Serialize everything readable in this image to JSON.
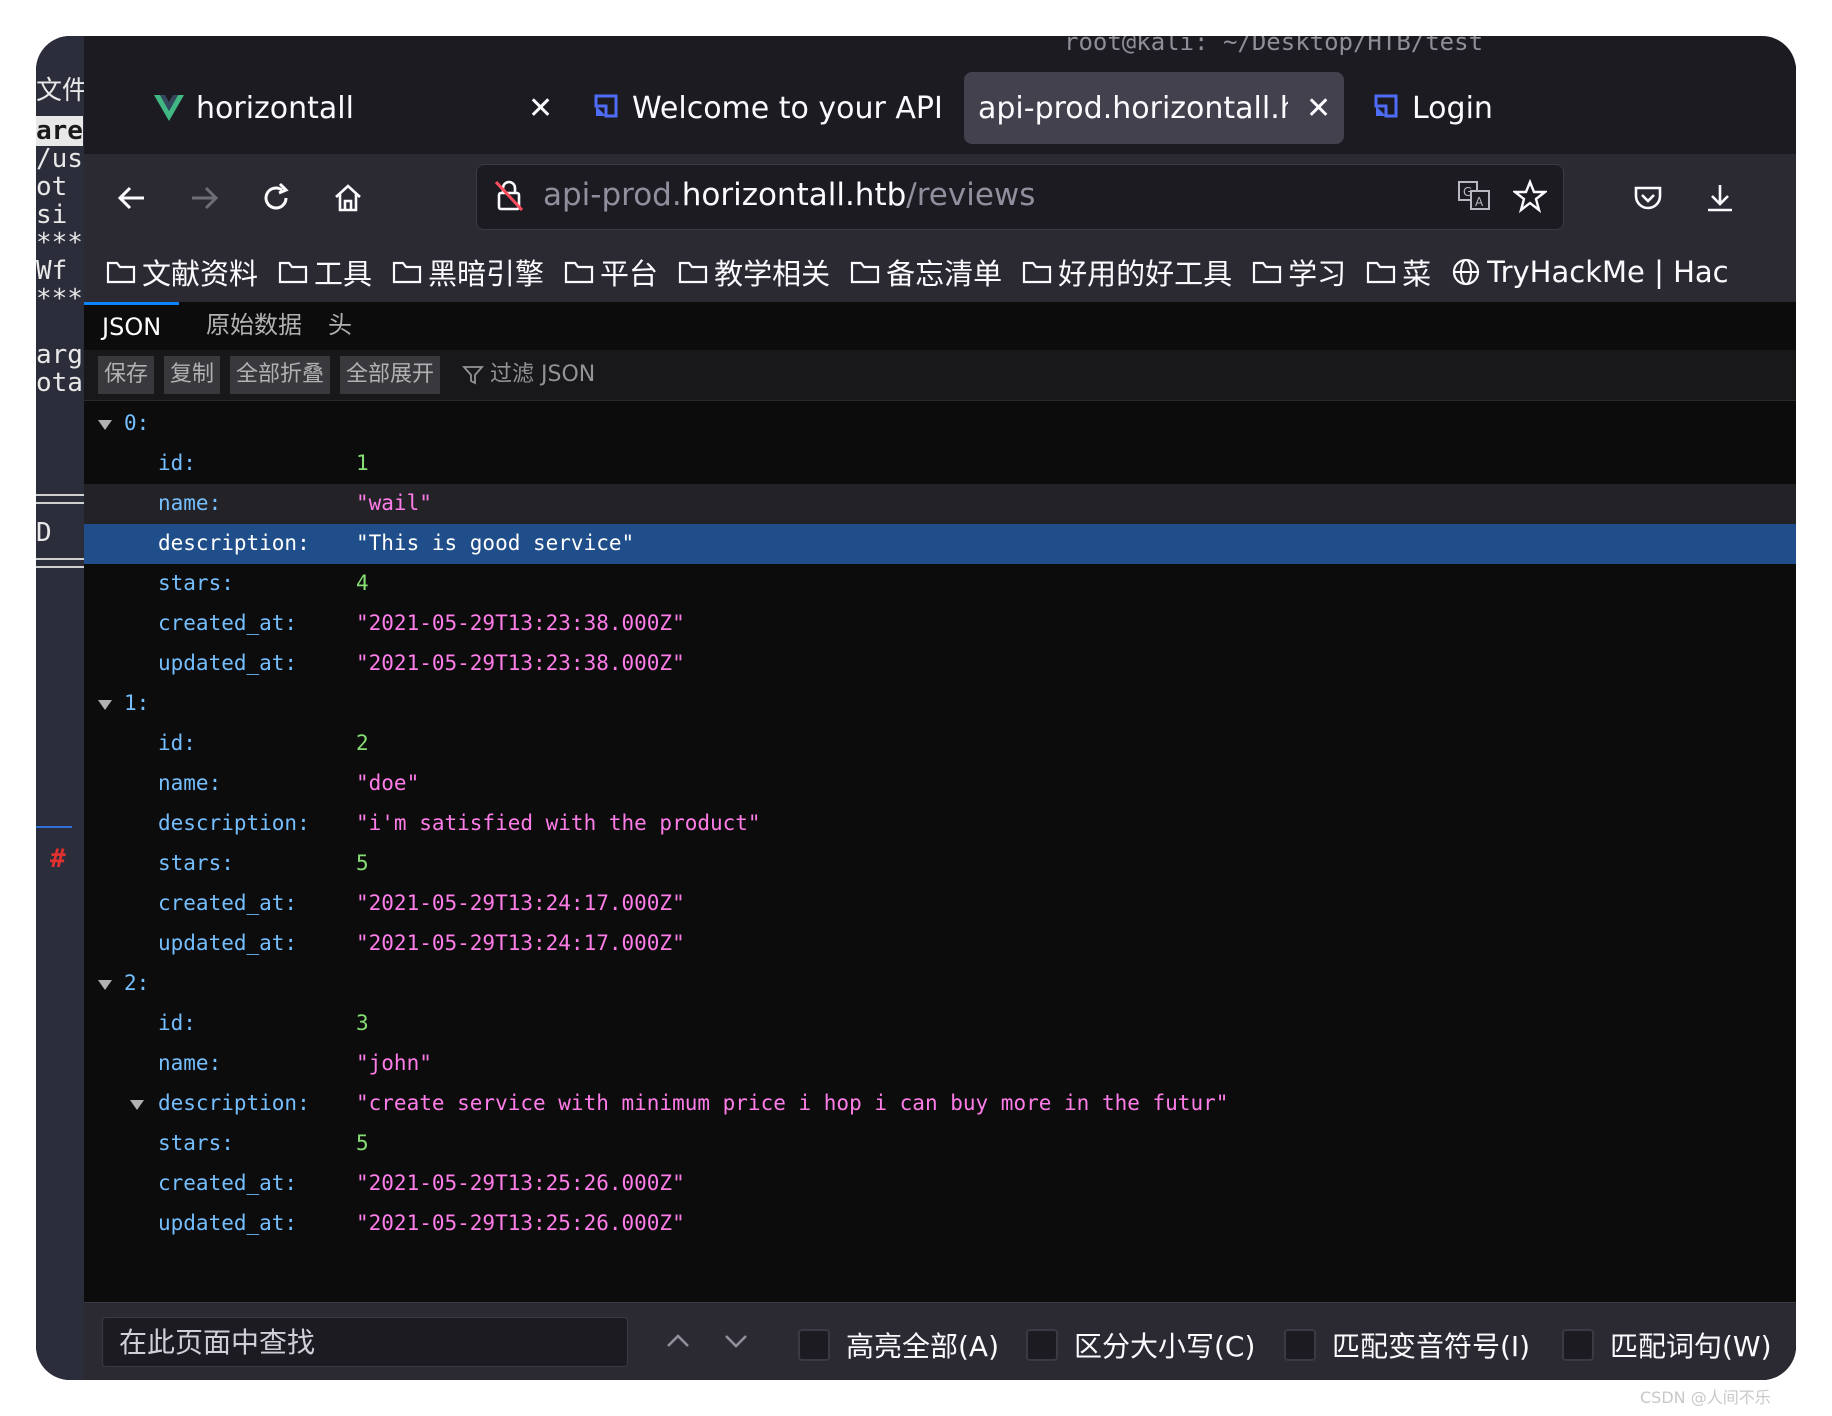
{
  "terminal": {
    "title": "root@kali: ~/Desktop/HTB/test",
    "lines": [
      "文件",
      "are",
      "/us",
      "ot",
      " si",
      "***",
      " Wf",
      "***",
      "arg",
      "ota",
      "D"
    ],
    "prompt_glyph": "#"
  },
  "tabs": [
    {
      "label": "horizontall",
      "icon": "vue-logo-icon",
      "active": false
    },
    {
      "label": "Welcome to your API",
      "icon": "strapi-logo-icon",
      "active": false
    },
    {
      "label": "api-prod.horizontall.htb/revie",
      "icon": "",
      "active": true
    },
    {
      "label": "Login",
      "icon": "strapi-logo-icon",
      "active": false
    }
  ],
  "urlbar": {
    "prefix": "api-prod.",
    "host": "horizontall.htb",
    "path": "/reviews"
  },
  "bookmarks": [
    "文献资料",
    "工具",
    "黑暗引擎",
    "平台",
    "教学相关",
    "备忘清单",
    "好用的好工具",
    "学习",
    "菜",
    "TryHackMe | Hac"
  ],
  "viewer": {
    "tabs": [
      "JSON",
      "原始数据",
      "头"
    ],
    "toolbar": {
      "save": "保存",
      "copy": "复制",
      "collapse_all": "全部折叠",
      "expand_all": "全部展开",
      "filter_placeholder": "过滤 JSON"
    }
  },
  "json_rows": [
    {
      "kind": "index",
      "key": "0:"
    },
    {
      "kind": "field",
      "key": "id:",
      "value": "1",
      "type": "num"
    },
    {
      "kind": "field",
      "key": "name:",
      "value": "\"wail\"",
      "type": "str",
      "state": "hover"
    },
    {
      "kind": "field",
      "key": "description:",
      "value": "\"This is good service\"",
      "type": "str",
      "state": "selected"
    },
    {
      "kind": "field",
      "key": "stars:",
      "value": "4",
      "type": "num"
    },
    {
      "kind": "field",
      "key": "created_at:",
      "value": "\"2021-05-29T13:23:38.000Z\"",
      "type": "str"
    },
    {
      "kind": "field",
      "key": "updated_at:",
      "value": "\"2021-05-29T13:23:38.000Z\"",
      "type": "str"
    },
    {
      "kind": "index",
      "key": "1:"
    },
    {
      "kind": "field",
      "key": "id:",
      "value": "2",
      "type": "num"
    },
    {
      "kind": "field",
      "key": "name:",
      "value": "\"doe\"",
      "type": "str"
    },
    {
      "kind": "field",
      "key": "description:",
      "value": "\"i'm satisfied with the product\"",
      "type": "str"
    },
    {
      "kind": "field",
      "key": "stars:",
      "value": "5",
      "type": "num"
    },
    {
      "kind": "field",
      "key": "created_at:",
      "value": "\"2021-05-29T13:24:17.000Z\"",
      "type": "str"
    },
    {
      "kind": "field",
      "key": "updated_at:",
      "value": "\"2021-05-29T13:24:17.000Z\"",
      "type": "str"
    },
    {
      "kind": "index",
      "key": "2:"
    },
    {
      "kind": "field",
      "key": "id:",
      "value": "3",
      "type": "num"
    },
    {
      "kind": "field",
      "key": "name:",
      "value": "\"john\"",
      "type": "str"
    },
    {
      "kind": "field",
      "key": "description:",
      "value": "\"create service with minimum price i hop i can buy more in the futur\"",
      "type": "str",
      "expandable": true
    },
    {
      "kind": "field",
      "key": "stars:",
      "value": "5",
      "type": "num"
    },
    {
      "kind": "field",
      "key": "created_at:",
      "value": "\"2021-05-29T13:25:26.000Z\"",
      "type": "str"
    },
    {
      "kind": "field",
      "key": "updated_at:",
      "value": "\"2021-05-29T13:25:26.000Z\"",
      "type": "str"
    }
  ],
  "findbar": {
    "placeholder": "在此页面中查找",
    "options": [
      "高亮全部(A)",
      "区分大小写(C)",
      "匹配变音符号(I)",
      "匹配词句(W)"
    ]
  },
  "watermark": "CSDN @人间不乐"
}
